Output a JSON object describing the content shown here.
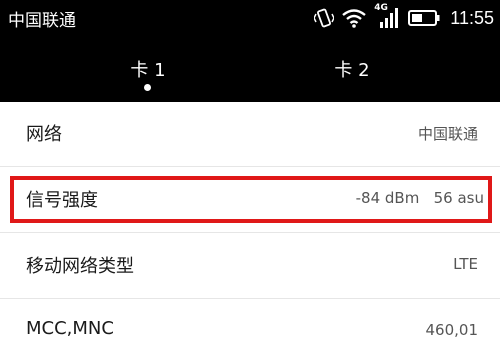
{
  "status_bar": {
    "carrier": "中国联通",
    "network_badge": "4G",
    "time": "11:55",
    "icons": [
      "vibrate-icon",
      "wifi-icon",
      "cellular-signal-icon",
      "battery-icon"
    ]
  },
  "tabs": [
    {
      "label": "卡 1",
      "selected": true
    },
    {
      "label": "卡 2",
      "selected": false
    }
  ],
  "rows": [
    {
      "label": "网络",
      "value": "中国联通"
    },
    {
      "label": "信号强度",
      "value": "-84 dBm   56 asu"
    },
    {
      "label": "移动网络类型",
      "value": "LTE"
    },
    {
      "label": "MCC,MNC",
      "value": "460,01"
    }
  ],
  "colors": {
    "bar_background": "#000000",
    "highlight": "#e01818",
    "list_background": "#ffffff"
  }
}
